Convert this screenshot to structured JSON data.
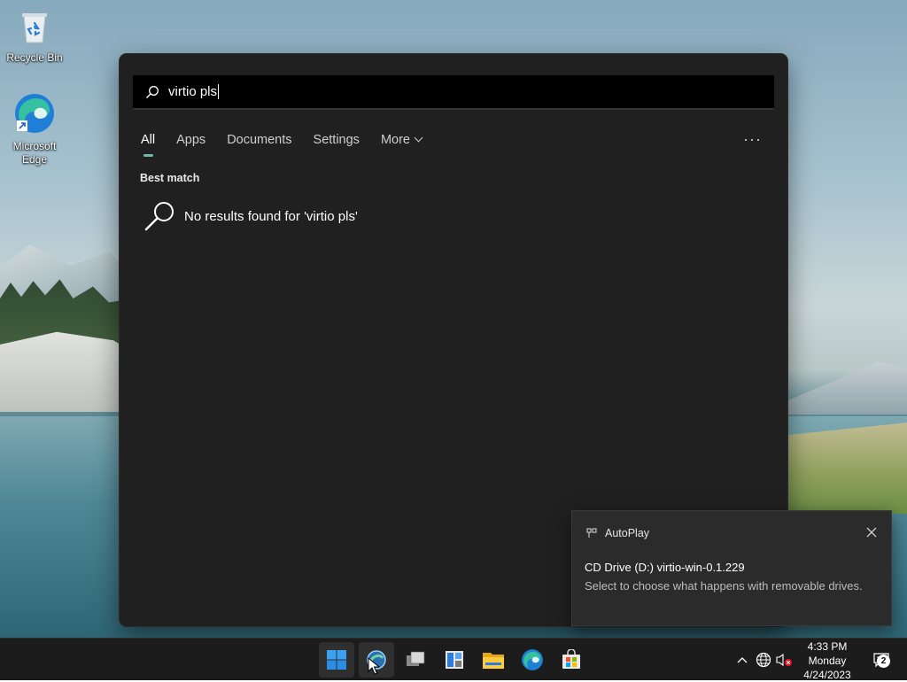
{
  "desktop": {
    "icons": [
      {
        "label": "Recycle Bin"
      },
      {
        "label_line1": "Microsoft",
        "label_line2": "Edge"
      }
    ]
  },
  "search": {
    "query": "virtio pls",
    "tabs": [
      {
        "label": "All",
        "active": true
      },
      {
        "label": "Apps"
      },
      {
        "label": "Documents"
      },
      {
        "label": "Settings"
      },
      {
        "label": "More"
      }
    ],
    "more_options": "···",
    "section_title": "Best match",
    "no_results": "No results found for 'virtio pls'",
    "accent": "#74b8a9"
  },
  "toast": {
    "app": "AutoPlay",
    "title": "CD Drive (D:) virtio-win-0.1.229",
    "body": "Select to choose what happens with removable drives."
  },
  "taskbar": {
    "apps": [
      "start-icon",
      "search-app-icon",
      "task-view-icon",
      "widgets-icon",
      "file-explorer-icon",
      "edge-icon",
      "store-icon"
    ],
    "clock": {
      "time": "4:33 PM",
      "day": "Monday",
      "date": "4/24/2023"
    },
    "notification_count": "2"
  }
}
